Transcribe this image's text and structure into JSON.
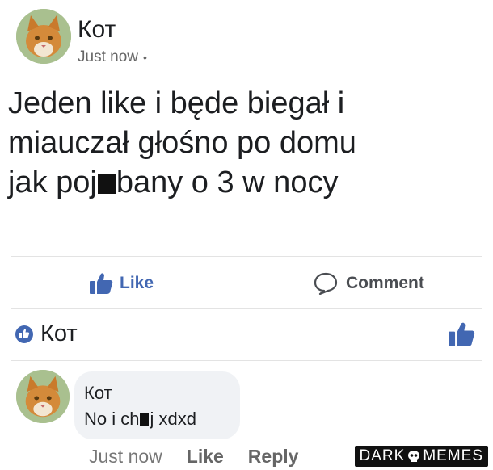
{
  "post": {
    "author": "Кот",
    "time": "Just now",
    "text_line1": "Jeden like i będe biegał i",
    "text_line2": "miauczał głośno po domu",
    "text_line3_a": "jak poj",
    "text_line3_b": "bany o 3 w nocy"
  },
  "actions": {
    "like_label": "Like",
    "comment_label": "Comment"
  },
  "reaction": {
    "name": "Кот"
  },
  "comment": {
    "author": "Кот",
    "text_a": "No i ch",
    "text_b": "j xdxd",
    "time": "Just now",
    "like_label": "Like",
    "reply_label": "Reply"
  },
  "watermark": {
    "text_a": "DARK",
    "text_b": "MEMES"
  },
  "colors": {
    "accent": "#4267b2",
    "bubble": "#f0f2f5"
  }
}
